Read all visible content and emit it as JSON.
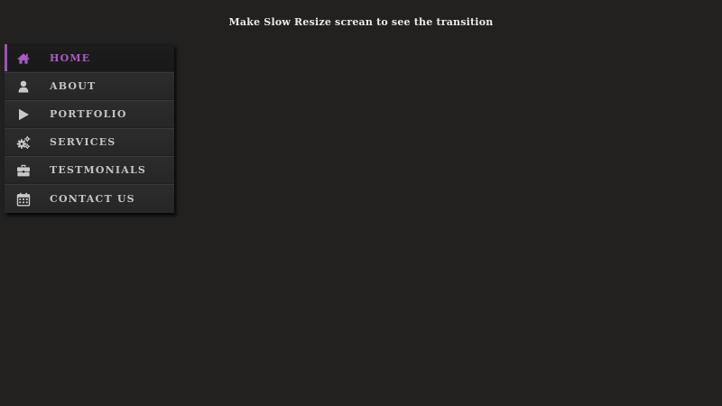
{
  "heading": "Make Slow Resize screan to see the transition",
  "colors": {
    "background": "#222120",
    "accent": "#a85cc4",
    "text": "#c4c4c4",
    "icon": "#c8c8c8"
  },
  "nav": {
    "items": [
      {
        "label": "HOME",
        "icon": "home-icon",
        "active": true
      },
      {
        "label": "ABOUT",
        "icon": "user-icon",
        "active": false
      },
      {
        "label": "PORTFOLIO",
        "icon": "play-icon",
        "active": false
      },
      {
        "label": "SERVICES",
        "icon": "gears-icon",
        "active": false
      },
      {
        "label": "TESTMONIALS",
        "icon": "briefcase-icon",
        "active": false
      },
      {
        "label": "CONTACT US",
        "icon": "calendar-icon",
        "active": false
      }
    ]
  }
}
